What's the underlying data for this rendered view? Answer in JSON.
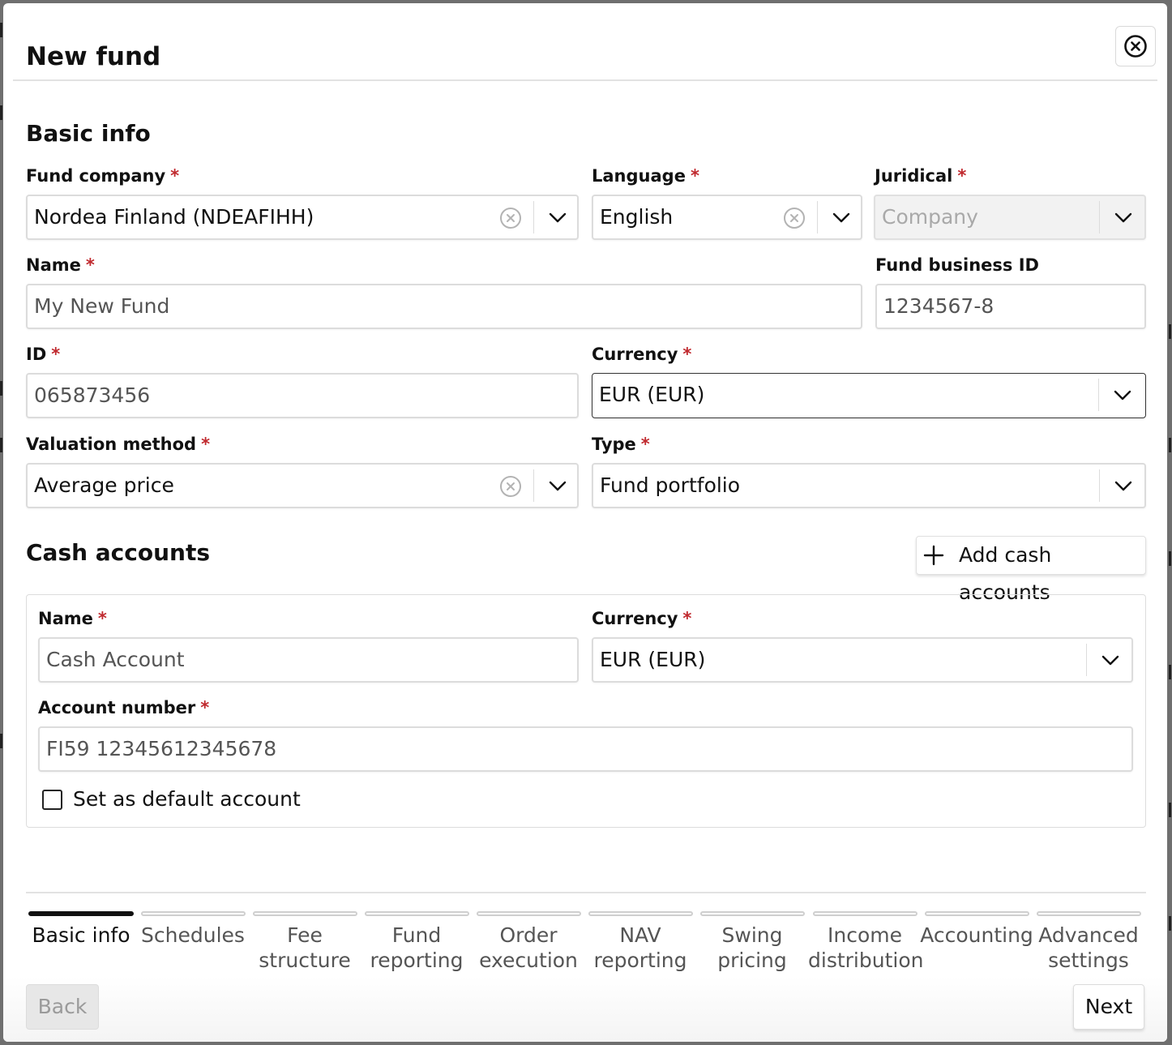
{
  "dialog": {
    "title": "New fund",
    "close_icon": "close-circle-icon"
  },
  "basic_info": {
    "section_title": "Basic info",
    "fund_company": {
      "label": "Fund company",
      "required": "*",
      "value": "Nordea Finland (NDEAFIHH)"
    },
    "language": {
      "label": "Language",
      "required": "*",
      "value": "English"
    },
    "juridical": {
      "label": "Juridical",
      "required": "*",
      "placeholder": "Company"
    },
    "name": {
      "label": "Name",
      "required": "*",
      "value": "My New Fund"
    },
    "fund_business_id": {
      "label": "Fund business ID",
      "value": "1234567-8"
    },
    "id": {
      "label": "ID",
      "required": "*",
      "value": "065873456"
    },
    "currency": {
      "label": "Currency",
      "required": "*",
      "value": "EUR (EUR)"
    },
    "valuation_method": {
      "label": "Valuation method",
      "required": "*",
      "value": "Average price"
    },
    "type": {
      "label": "Type",
      "required": "*",
      "value": "Fund portfolio"
    }
  },
  "cash_accounts": {
    "section_title": "Cash accounts",
    "add_button": "Add cash accounts",
    "account": {
      "name": {
        "label": "Name",
        "required": "*",
        "value": "Cash Account"
      },
      "currency": {
        "label": "Currency",
        "required": "*",
        "value": "EUR (EUR)"
      },
      "account_number": {
        "label": "Account number",
        "required": "*",
        "value": "FI59 12345612345678"
      },
      "default_checkbox_label": "Set as default account"
    }
  },
  "steps": [
    {
      "line1": "Basic info",
      "line2": ""
    },
    {
      "line1": "Schedules",
      "line2": ""
    },
    {
      "line1": "Fee",
      "line2": "structure"
    },
    {
      "line1": "Fund",
      "line2": "reporting"
    },
    {
      "line1": "Order",
      "line2": "execution"
    },
    {
      "line1": "NAV",
      "line2": "reporting"
    },
    {
      "line1": "Swing",
      "line2": "pricing"
    },
    {
      "line1": "Income",
      "line2": "distribution"
    },
    {
      "line1": "Accounting",
      "line2": ""
    },
    {
      "line1": "Advanced",
      "line2": "settings"
    }
  ],
  "footer": {
    "back_label": "Back",
    "next_label": "Next"
  },
  "colors": {
    "required_marker": "#c0292e",
    "active_step": "#111111",
    "inactive_step_text": "#555555"
  }
}
